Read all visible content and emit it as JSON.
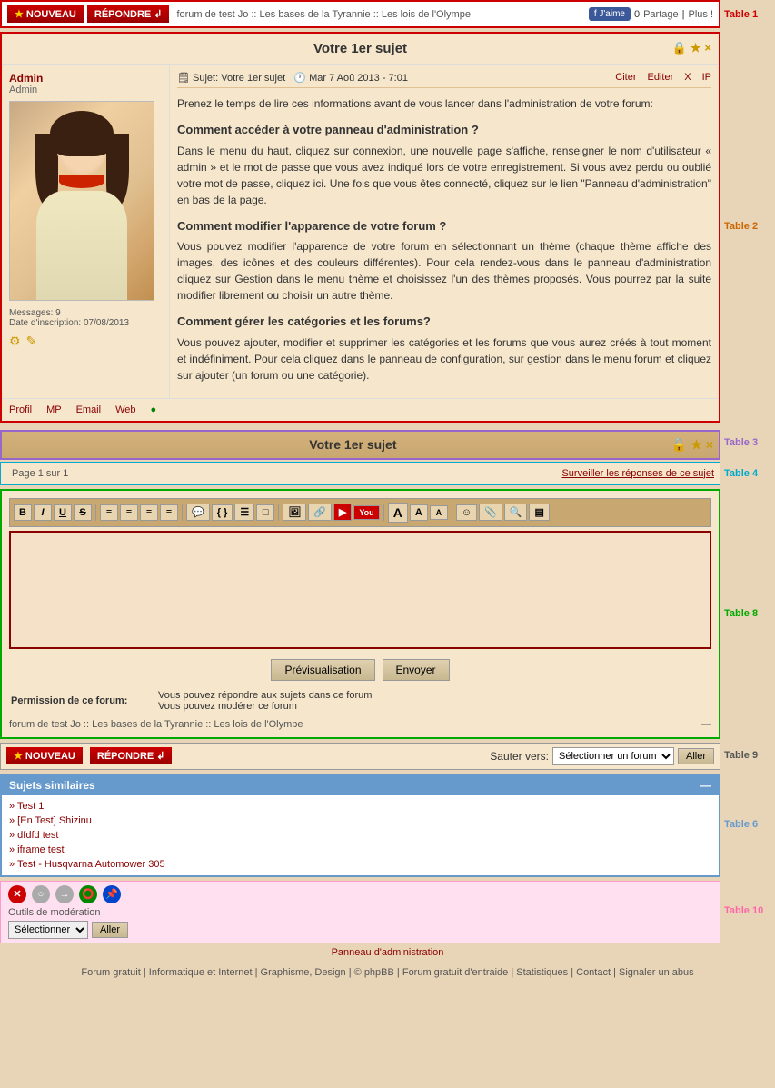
{
  "toolbar": {
    "nouveau_label": "NOUVEAU",
    "repondre_label": "RÉPONDRE",
    "breadcrumb": "forum de test Jo :: Les bases de la Tyrannie :: Les lois de l'Olympe",
    "fb_label": "J'aime",
    "share_label": "Partage",
    "plus_label": "Plus !"
  },
  "post": {
    "title": "Votre 1er sujet",
    "author_name": "Admin",
    "author_role": "Admin",
    "subject_label": "Sujet:",
    "subject": "Votre 1er sujet",
    "date": "Mar 7 Aoû 2013 - 7:01",
    "action_cite": "Citer",
    "action_editer": "Editer",
    "action_x": "X",
    "action_ip": "IP",
    "content_intro": "Prenez le temps de lire ces informations avant de vous lancer dans l'administration de votre forum:",
    "h1": "Comment accéder à votre panneau d'administration ?",
    "p1": "Dans le menu du haut, cliquez sur connexion, une nouvelle page s'affiche, renseigner le nom d'utilisateur « admin » et le mot de passe que vous avez indiqué lors de votre enregistrement. Si vous avez perdu ou oublié votre mot de passe, cliquez ici. Une fois que vous êtes connecté, cliquez sur le lien \"Panneau d'administration\" en bas de la page.",
    "h2": "Comment modifier l'apparence de votre forum ?",
    "p2": "Vous pouvez modifier l'apparence de votre forum en sélectionnant un thème (chaque thème affiche des images, des icônes et des couleurs différentes). Pour cela rendez-vous dans le panneau d'administration cliquez sur Gestion dans le menu thème et choisissez l'un des thèmes proposés. Vous pourrez par la suite modifier librement ou choisir un autre thème.",
    "h3": "Comment gérer les catégories et les forums?",
    "p3": "Vous pouvez ajouter, modifier et supprimer les catégories et les forums que vous aurez créés à tout moment et indéfiniment. Pour cela cliquez dans le panneau de configuration, sur gestion dans le menu forum et cliquez sur ajouter (un forum ou une catégorie).",
    "messages_label": "Messages:",
    "messages_count": "9",
    "date_inscription_label": "Date d'inscription:",
    "date_inscription": "07/08/2013",
    "profil": "Profil",
    "mp": "MP",
    "email": "Email",
    "web": "Web"
  },
  "section": {
    "title": "Votre 1er sujet",
    "page_info": "Page 1 sur 1",
    "surveiller": "Surveiller les réponses de ce sujet"
  },
  "editor": {
    "btn_bold": "B",
    "btn_italic": "I",
    "btn_underline": "U",
    "btn_strike": "S",
    "btn_preview": "Prévisualisation",
    "btn_send": "Envoyer",
    "textarea_placeholder": ""
  },
  "permissions": {
    "label": "Permission de ce forum:",
    "line1": "Vous pouvez répondre aux sujets dans ce forum",
    "line2": "Vous pouvez modérer ce forum"
  },
  "navigation": {
    "nouveau_label": "NOUVEAU",
    "repondre_label": "RÉPONDRE",
    "jump_label": "Sauter vers:",
    "jump_placeholder": "Sélectionner un forum",
    "aller_label": "Aller"
  },
  "similar_topics": {
    "header": "Sujets similaires",
    "items": [
      "» Test 1",
      "» [En Test] Shizinu",
      "» dfdfd test",
      "» iframe test",
      "» Test - Husqvarna Automower 305"
    ]
  },
  "moderation": {
    "label": "Outils de modération",
    "select_placeholder": "Sélectionner",
    "aller_label": "Aller"
  },
  "footer": {
    "admin_panel": "Panneau d'administration",
    "links": [
      "Forum gratuit",
      "Informatique et Internet",
      "Graphisme, Design",
      "© phpBB",
      "Forum gratuit d'entraide",
      "Statistiques",
      "Contact",
      "Signaler un abus"
    ]
  },
  "table_labels": {
    "t1": "Table 1",
    "t2": "Table 2",
    "t3": "Table 3",
    "t4": "Table 4",
    "t8": "Table 8",
    "t9": "Table 9",
    "t6": "Table 6",
    "t10": "Table 10"
  }
}
